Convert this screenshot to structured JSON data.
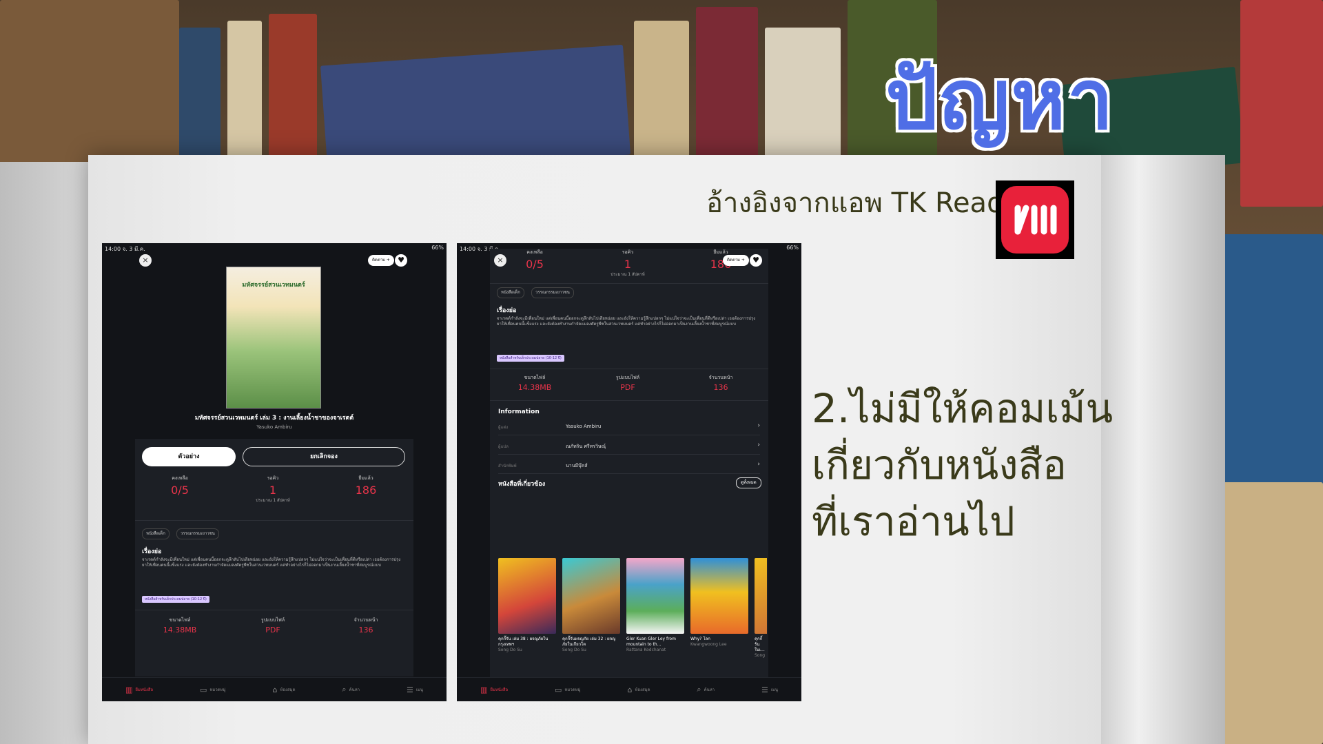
{
  "slide": {
    "title": "ปัญหา",
    "reference": "อ้างอิงจากแอพ TK Read",
    "point_lines": [
      "2.ไม่มีให้คอมเม้น",
      "เกี่ยวกับหนังสือ",
      "ที่เราอ่านไป"
    ],
    "title_color": "#4f6ee6",
    "logo_color": "#e8213a"
  },
  "app": {
    "status_time": "14:00  จ. 3 มี.ค.",
    "status_right": "66%",
    "follow_label": "ติดตาม +",
    "book_title": "มหัศจรรย์สวนเวทมนตร์ เล่ม 3 : งานเลี้ยงน้ำชาของจาเรตต์",
    "cover_title": "มหัศจรรย์สวนเวทมนตร์",
    "author": "Yasuko Ambiru",
    "sample_button": "ตัวอย่าง",
    "cancel_button": "ยกเลิกจอง",
    "stats": [
      {
        "label": "คงเหลือ",
        "value": "0/5"
      },
      {
        "label": "รอคิว",
        "value": "1",
        "sub": "ประมาณ 1 สัปดาห์"
      },
      {
        "label": "ยืมแล้ว",
        "value": "186"
      }
    ],
    "chips": [
      "หนังสือเด็ก",
      "วรรณกรรมเยาวชน"
    ],
    "story_heading": "เรื่องย่อ",
    "story_text": "จาเรตต์กำลังจะมีเพื่อนใหม่ แต่เพื่อนคนนี้ออกจะดูลึกลับไปเสียหน่อย และยังให้ความรู้สึกแปลกๆ ไม่แน่ใจว่าจะเป็นเพื่อนที่ดีหรือเปล่า เธอต้องการปรุงยาให้เพื่อนคนนี้แข็งแรง และยังต้องทำงานกำจัดแมลงศัตรูพืชในสวนเวทมนตร์ แต่ทำอย่างไรก็ไม่ออกมาเป็นงานเลี้ยงน้ำชาที่สมบูรณ์แบบ",
    "age_tag": "หนังสือสำหรับเด็กประถมปลาย (10-12 ปี)",
    "file_stats": [
      {
        "label": "ขนาดไฟล์",
        "value": "14.38MB"
      },
      {
        "label": "รูปแบบไฟล์",
        "value": "PDF"
      },
      {
        "label": "จำนวนหน้า",
        "value": "136"
      }
    ],
    "info_heading": "Information",
    "info_rows": [
      {
        "key": "ผู้แต่ง",
        "value": "Yasuko Ambiru"
      },
      {
        "key": "ผู้แปล",
        "value": "ณภัทริน ศรีทรวิษณุ์"
      },
      {
        "key": "สำนักพิมพ์",
        "value": "นานมีบุ๊คส์"
      }
    ],
    "related_heading": "หนังสือที่เกี่ยวข้อง",
    "see_all": "ดูทั้งหมด",
    "related_books": [
      {
        "title": "คุกกี้รัน เล่ม 38 : ผจญภัยในกรุงเทพฯ",
        "author": "Song Do Su",
        "color": "#d4463a"
      },
      {
        "title": "คุกกี้รันผจญภัย เล่ม 32 : ผจญภัยในเกียวโต",
        "author": "Song Do Su",
        "color": "#c98a3a"
      },
      {
        "title": "Gler Kuan Gler Ley from mountain to th...",
        "author": "Rattana Kodchanat",
        "color": "#4aa2c9"
      },
      {
        "title": "Why? โลก",
        "author": "Kwangwoong Lee",
        "color": "#2f8fd8"
      },
      {
        "title": "คุกกี้รัน ในเ...",
        "author": "Song",
        "color": "#c9653a"
      }
    ],
    "tabs": [
      {
        "label": "ยืมหนังสือ",
        "icon": "book-icon"
      },
      {
        "label": "หมวดหมู่",
        "icon": "folder-icon"
      },
      {
        "label": "ห้องสมุด",
        "icon": "home-icon"
      },
      {
        "label": "ค้นหา",
        "icon": "search-icon"
      },
      {
        "label": "เมนู",
        "icon": "menu-icon"
      }
    ]
  }
}
